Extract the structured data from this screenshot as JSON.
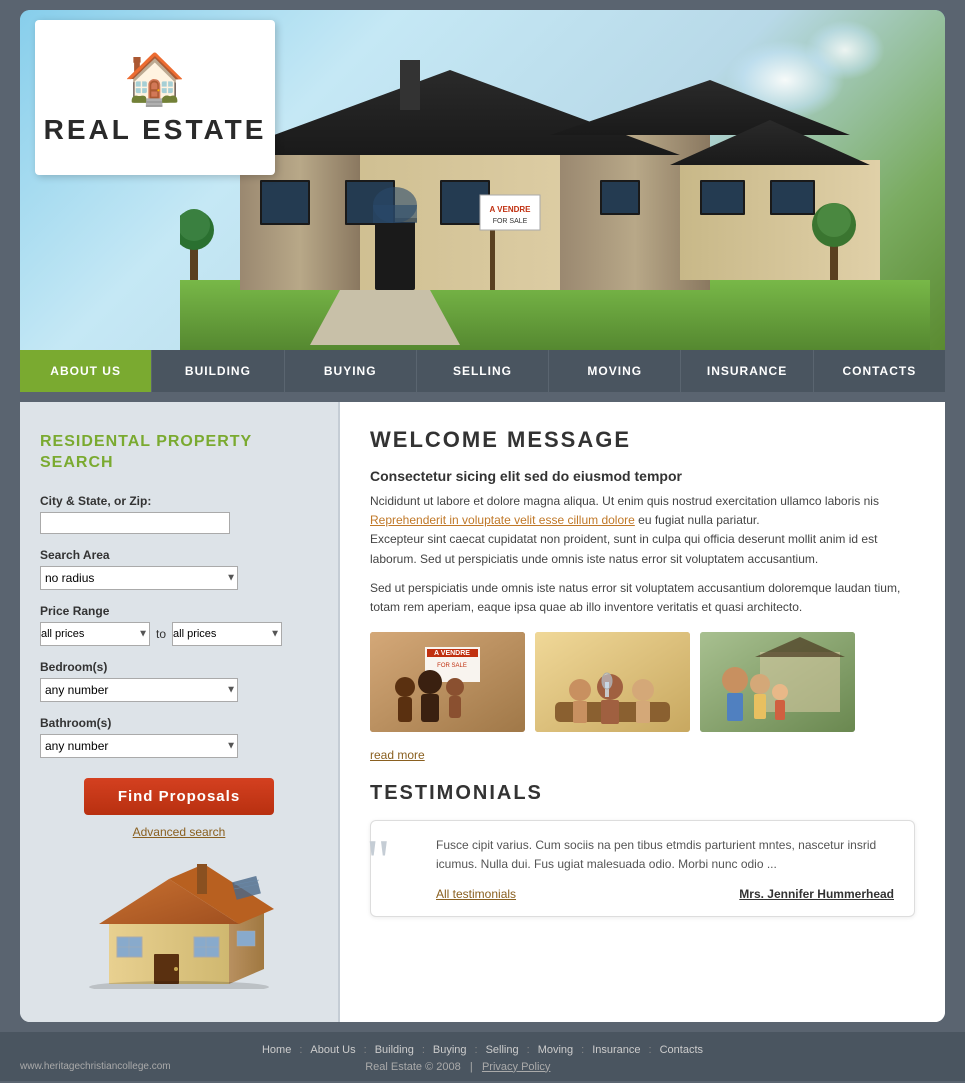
{
  "site": {
    "title": "REAL ESTATE",
    "logo_icon": "🏠",
    "tagline": "Real Estate"
  },
  "nav": {
    "items": [
      {
        "label": "ABOUT US",
        "active": true
      },
      {
        "label": "BUILDING",
        "active": false
      },
      {
        "label": "BUYING",
        "active": false
      },
      {
        "label": "SELLING",
        "active": false
      },
      {
        "label": "MOVING",
        "active": false
      },
      {
        "label": "INSURANCE",
        "active": false
      },
      {
        "label": "CONTACTS",
        "active": false
      }
    ]
  },
  "sidebar": {
    "title": "RESIDENTAL PROPERTY\nSEARCH",
    "city_label": "City & State, or Zip:",
    "city_placeholder": "",
    "search_area_label": "Search Area",
    "search_area_default": "no radius",
    "price_range_label": "Price Range",
    "price_to_label": "to",
    "price_from_default": "all prices",
    "price_to_default": "all prices",
    "bedrooms_label": "Bedroom(s)",
    "bedrooms_default": "any number",
    "bathrooms_label": "Bathroom(s)",
    "bathrooms_default": "any number",
    "find_btn": "Find Proposals",
    "advanced_link": "Advanced search"
  },
  "content": {
    "welcome_title": "WELCOME MESSAGE",
    "subtitle": "Consectetur sicing elit sed do eiusmod tempor",
    "para1": "Ncididunt ut labore et dolore magna aliqua. Ut enim quis nostrud  exercitation ullamco laboris nis",
    "link_text": "Reprehenderit in voluptate velit esse cillum dolore",
    "para1b": " eu fugiat nulla pariatur.",
    "para1c": "Excepteur sint caecat cupidatat non proident, sunt in culpa qui officia deserunt mollit anim id est laborum. Sed ut perspiciatis unde omnis iste natus error sit voluptatem accusantium.",
    "para2": "Sed ut perspiciatis unde omnis iste natus error sit voluptatem accusantium doloremque laudan tium, totam rem aperiam, eaque ipsa quae ab illo inventore veritatis et quasi architecto.",
    "read_more": "read more",
    "testimonials_title": "TESTIMONIALS",
    "testimonial_text": "Fusce cipit varius. Cum sociis na pen tibus etmdis parturient mntes, nascetur insrid icumus. Nulla dui. Fus ugiat malesuada odio. Morbi nunc odio ...",
    "all_testimonials": "All testimonials",
    "testimonial_author": "Mrs. Jennifer Hummerhead"
  },
  "footer": {
    "links": [
      "Home",
      "About Us",
      "Building",
      "Buying",
      "Selling",
      "Moving",
      "Insurance",
      "Contacts"
    ],
    "url": "www.heritagechristiancollege.com",
    "copyright": "Real Estate © 2008",
    "privacy": "Privacy Policy"
  }
}
